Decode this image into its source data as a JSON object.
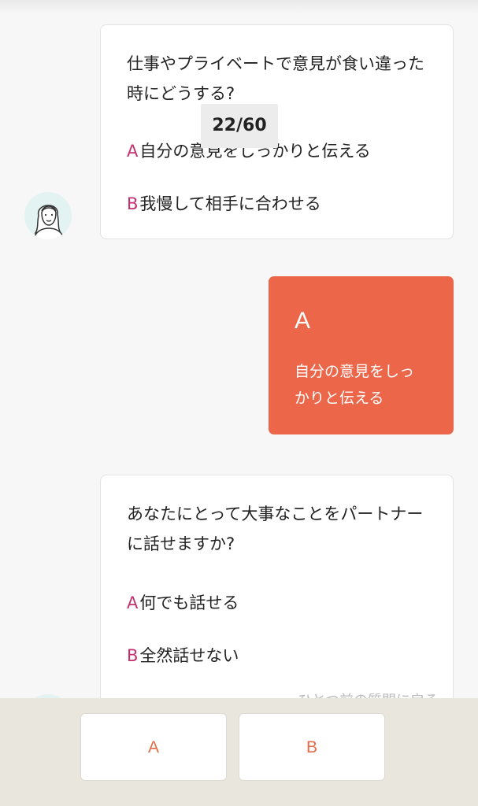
{
  "progress": "22/60",
  "question1": {
    "text": "仕事やプライベートで意見が食い違った時にどうする?",
    "option_a_letter": "A",
    "option_a": "自分の意見をしっかりと伝える",
    "option_b_letter": "B",
    "option_b": "我慢して相手に合わせる"
  },
  "answer1": {
    "letter": "A",
    "text": "自分の意見をしっかりと伝える"
  },
  "question2": {
    "text": "あなたにとって大事なことをパートナーに話せますか?",
    "option_a_letter": "A",
    "option_a": "何でも話せる",
    "option_b_letter": "B",
    "option_b": "全然話せない"
  },
  "faded_text": "ひとつ前の質問に戻る",
  "buttons": {
    "a_label": "A",
    "b_label": "B"
  },
  "colors": {
    "accent": "#ec6649",
    "option_letter": "#c2306e",
    "button_text": "#e66a45"
  }
}
